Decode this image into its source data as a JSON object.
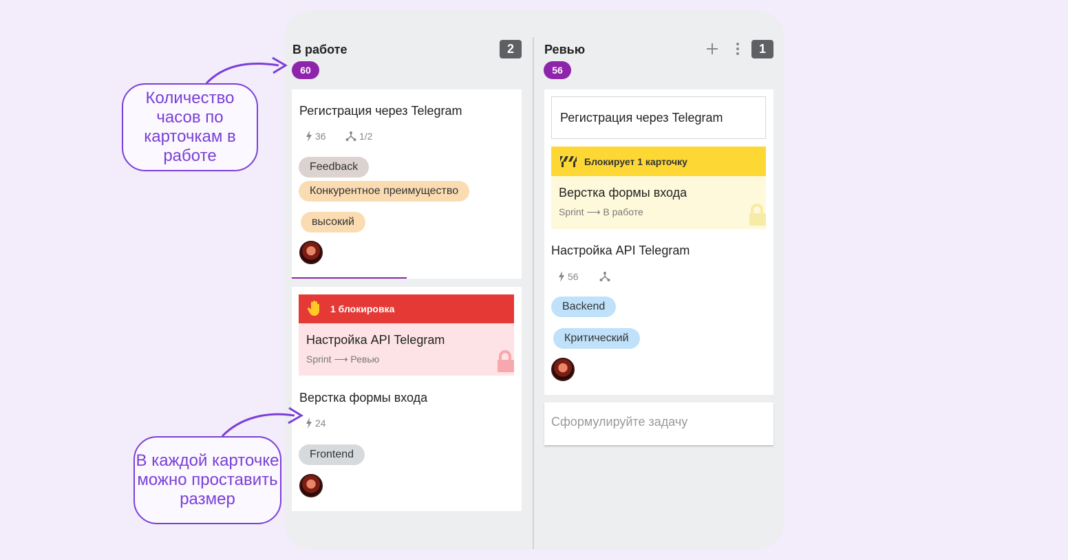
{
  "columns": [
    {
      "title": "В работе",
      "count": "2",
      "hours": "60",
      "cards": [
        {
          "title": "Регистрация через Telegram",
          "size": "36",
          "subtasks": "1/2",
          "tags": [
            "Feedback",
            "Конкурентное преимущество",
            "высокий"
          ]
        },
        {
          "blocker_label": "1 блокировка",
          "blocker": {
            "title": "Настройка API Telegram",
            "path": "Sprint ⟶ Ревью"
          },
          "title": "Верстка формы входа",
          "size": "24",
          "tags": [
            "Frontend"
          ]
        }
      ]
    },
    {
      "title": "Ревью",
      "count": "1",
      "hours": "56",
      "cards": [
        {
          "linked_title": "Регистрация через Telegram",
          "blocks_label": "Блокирует 1 карточку",
          "blocked": {
            "title": "Верстка формы входа",
            "path": "Sprint ⟶ В работе"
          },
          "title": "Настройка API Telegram",
          "size": "56",
          "tags": [
            "Backend",
            "Критический"
          ]
        }
      ],
      "new_task_placeholder": "Сформулируйте задачу"
    }
  ],
  "callouts": {
    "hours": "Количество часов по карточкам в работе",
    "size": "В каждой карточке можно проставить размер"
  },
  "icons": {
    "size": "lightning-icon",
    "subtasks": "subtasks-icon",
    "blocker": "hand-stop-icon",
    "blocks": "barrier-icon",
    "lock": "lock-icon",
    "add": "plus-icon",
    "menu": "more-vert-icon"
  },
  "colors": {
    "accent": "#8e24aa",
    "blocker": "#e53935",
    "blocker_bg": "#fde3e5",
    "blocks": "#fdd835",
    "blocks_bg": "#fff9dc",
    "callout": "#7a3fd6"
  }
}
